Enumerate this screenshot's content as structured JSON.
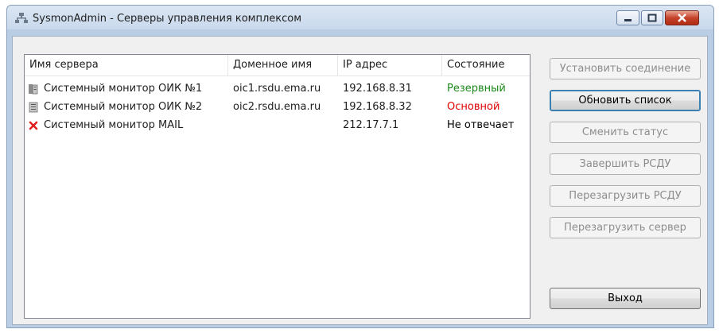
{
  "window": {
    "title": "SysmonAdmin - Серверы управления комплексом"
  },
  "table": {
    "columns": [
      "Имя сервера",
      "Доменное имя",
      "IP адрес",
      "Состояние"
    ],
    "rows": [
      {
        "name": "Системный монитор ОИК №1",
        "domain": "oic1.rsdu.ema.ru",
        "ip": "192.168.8.31",
        "status": "Резервный",
        "status_color": "#1a8a1a",
        "icon": "server-icon"
      },
      {
        "name": "Системный монитор ОИК №2",
        "domain": "oic2.rsdu.ema.ru",
        "ip": "192.168.8.32",
        "status": "Основной",
        "status_color": "#e00000",
        "icon": "server-icon"
      },
      {
        "name": "Системный монитор MAIL",
        "domain": "",
        "ip": "212.17.7.1",
        "status": "Не отвечает",
        "status_color": "#000000",
        "icon": "error-x-icon"
      }
    ]
  },
  "buttons": {
    "connect": "Установить соединение",
    "refresh": "Обновить список",
    "change_status": "Сменить статус",
    "stop_rsdu": "Завершить РСДУ",
    "restart_rsdu": "Перезагрузить РСДУ",
    "restart_server": "Перезагрузить сервер",
    "exit": "Выход"
  }
}
